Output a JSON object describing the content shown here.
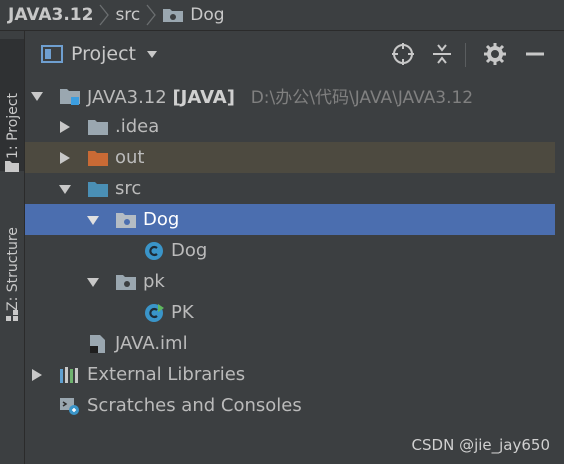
{
  "breadcrumb": {
    "project": "JAVA3.12",
    "folder": "src",
    "item": "Dog"
  },
  "strip": {
    "project_tab": "1: Project",
    "structure_tab": "Z: Structure"
  },
  "panel": {
    "title": "Project",
    "buttons": [
      "locate-icon",
      "collapse-all-icon",
      "gear-icon",
      "hide-icon"
    ]
  },
  "tree": {
    "root_name": "JAVA3.12",
    "root_module": "[JAVA]",
    "root_path": "D:\\办公\\代码\\JAVA\\JAVA3.12",
    "idea": ".idea",
    "out": "out",
    "src": "src",
    "dog_package": "Dog",
    "dog_class": "Dog",
    "pk_package": "pk",
    "pk_class": "PK",
    "iml": "JAVA.iml",
    "external": "External Libraries",
    "scratches": "Scratches and Consoles"
  },
  "watermark": "CSDN @jie_jay650",
  "colors": {
    "background": "#3c3f41",
    "selection": "#4b6eaf",
    "out_highlight": "#4d4a40",
    "folder_blue": "#4a8fb5",
    "folder_orange": "#c96a35",
    "folder_gray": "#9aa7b0",
    "class_icon": "#3a95c9"
  }
}
